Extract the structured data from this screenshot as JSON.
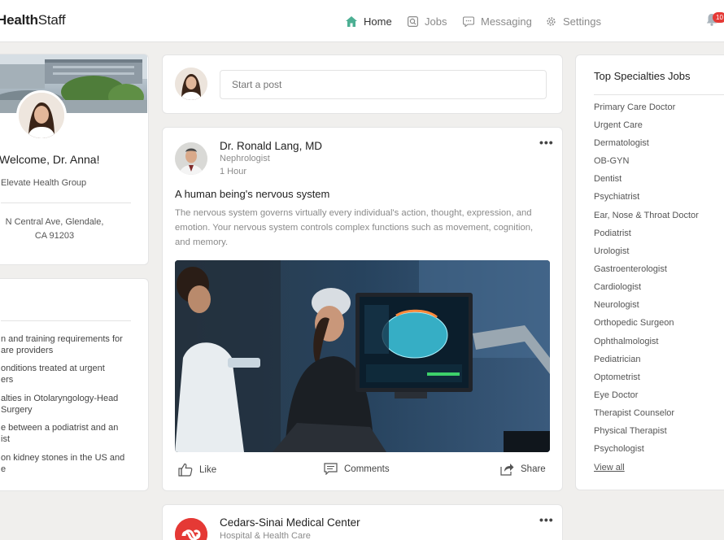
{
  "app": {
    "brand_bold": "Health",
    "brand_light": "Staff"
  },
  "nav": {
    "items": [
      {
        "label": "Home",
        "icon": "home-icon"
      },
      {
        "label": "Jobs",
        "icon": "search-icon"
      },
      {
        "label": "Messaging",
        "icon": "chat-icon"
      },
      {
        "label": "Settings",
        "icon": "gear-icon"
      }
    ],
    "notifications_count": "10"
  },
  "colors": {
    "accent": "#4caf93",
    "badge": "#e53935",
    "brand_red": "#e53935"
  },
  "profile": {
    "welcome": "Welcome, Dr. Anna!",
    "organization": "Elevate Health Group",
    "address_line1": "N Central Ave, Glendale,",
    "address_line2": "CA 91203"
  },
  "left_list": {
    "items": [
      {
        "line1": "n and training requirements for",
        "line2": "are providers"
      },
      {
        "line1": "onditions treated at urgent",
        "line2": "ers"
      },
      {
        "line1": "alties in Otolaryngology-Head",
        "line2": " Surgery"
      },
      {
        "line1": "e between a podiatrist and an",
        "line2": "ist"
      },
      {
        "line1": "on kidney stones in the US and",
        "line2": "e"
      }
    ]
  },
  "composer": {
    "placeholder": "Start a post"
  },
  "post": {
    "author": "Dr. Ronald Lang, MD",
    "role": "Nephrologist",
    "time": "1 Hour",
    "title": "A human being's nervous system",
    "body": "The nervous system governs virtually every individual's action, thought, expression, and emotion. Your nervous system controls complex functions such as movement, cognition, and memory.",
    "actions": {
      "like": "Like",
      "comments": "Comments",
      "share": "Share"
    }
  },
  "post2": {
    "author": "Cedars-Sinai Medical Center",
    "subtitle": "Hospital & Health Care"
  },
  "specialties": {
    "title": "Top Specialties Jobs",
    "items": [
      "Primary Care Doctor",
      "Urgent Care",
      "Dermatologist",
      "OB-GYN",
      "Dentist",
      "Psychiatrist",
      "Ear, Nose & Throat Doctor",
      "Podiatrist",
      "Urologist",
      "Gastroenterologist",
      "Cardiologist",
      "Neurologist",
      "Orthopedic Surgeon",
      "Ophthalmologist",
      "Pediatrician",
      "Optometrist",
      "Eye Doctor",
      "Therapist Counselor",
      "Physical Therapist",
      "Psychologist"
    ],
    "view_all": "View all"
  }
}
